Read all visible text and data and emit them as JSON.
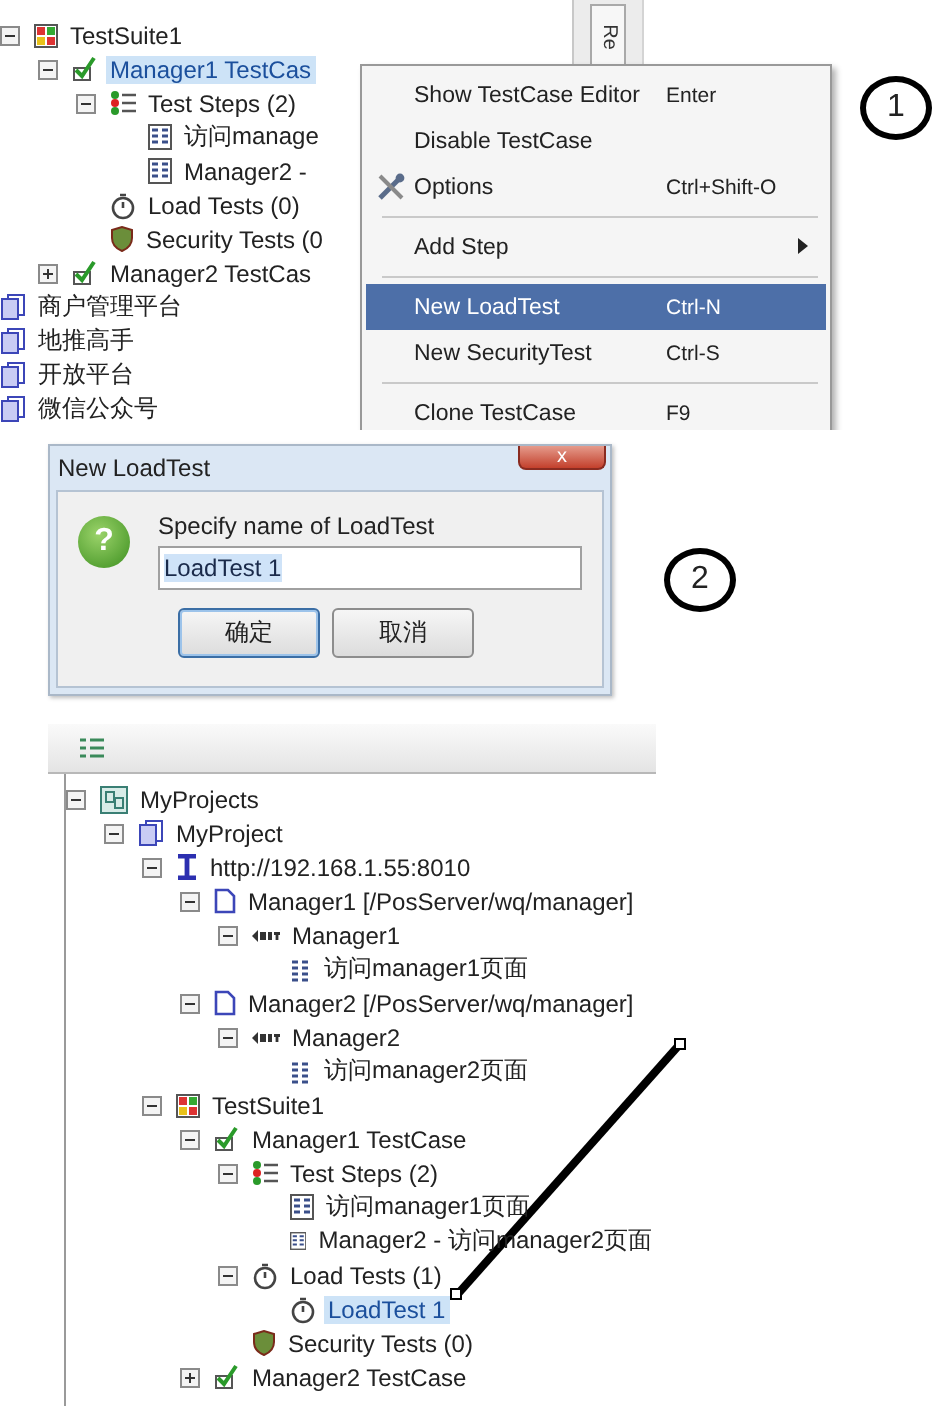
{
  "panel_1": {
    "tree": [
      {
        "label": "TestSuite1",
        "kind": "suite",
        "expanded": true,
        "selected": false,
        "children": [
          {
            "label": "Manager1 TestCas",
            "kind": "testcase",
            "expanded": true,
            "selected": true,
            "children": [
              {
                "label": "Test Steps (2)",
                "kind": "steps",
                "expanded": true,
                "selected": false,
                "children": [
                  {
                    "label": "访问manage",
                    "kind": "request",
                    "selected": false
                  },
                  {
                    "label": "Manager2 -",
                    "kind": "request",
                    "selected": false
                  }
                ]
              },
              {
                "label": "Load Tests (0)",
                "kind": "loadtest",
                "selected": false
              },
              {
                "label": "Security Tests (0",
                "kind": "security",
                "selected": false
              }
            ]
          },
          {
            "label": "Manager2 TestCas",
            "kind": "testcase",
            "expanded": false,
            "selected": false
          }
        ]
      },
      {
        "label": "商户管理平台",
        "kind": "project",
        "selected": false
      },
      {
        "label": "地推高手",
        "kind": "project",
        "selected": false
      },
      {
        "label": "开放平台",
        "kind": "project",
        "selected": false
      },
      {
        "label": "微信公众号",
        "kind": "project",
        "selected": false
      }
    ],
    "side_tab": "Re",
    "context_menu": [
      {
        "kind": "item",
        "label": "Show TestCase Editor",
        "shortcut": "Enter",
        "selected": false
      },
      {
        "kind": "item",
        "label": "Disable TestCase",
        "selected": false
      },
      {
        "kind": "icon_item",
        "label": "Options",
        "shortcut": "Ctrl+Shift-O",
        "selected": false
      },
      {
        "kind": "separator"
      },
      {
        "kind": "submenu",
        "label": "Add Step",
        "selected": false
      },
      {
        "kind": "separator"
      },
      {
        "kind": "item",
        "label": "New LoadTest",
        "shortcut": "Ctrl-N",
        "selected": true
      },
      {
        "kind": "item",
        "label": "New SecurityTest",
        "shortcut": "Ctrl-S",
        "selected": false
      },
      {
        "kind": "separator"
      },
      {
        "kind": "item",
        "label": "Clone TestCase",
        "shortcut": "F9",
        "selected": false
      }
    ],
    "step_marker": "1"
  },
  "panel_2": {
    "dialog": {
      "title": "New LoadTest",
      "close": "x",
      "help_icon": "?",
      "prompt": "Specify name of LoadTest",
      "value": "LoadTest 1",
      "value_selected": true,
      "buttons": [
        {
          "label": "确定",
          "default": true
        },
        {
          "label": "取消",
          "default": false
        }
      ]
    },
    "step_marker": "2"
  },
  "panel_3": {
    "tree": [
      {
        "label": "MyProjects",
        "kind": "projects",
        "selected": false,
        "expanded": true,
        "children": [
          {
            "label": "MyProject",
            "kind": "project",
            "expanded": true,
            "selected": false,
            "children": [
              {
                "label": "http://192.168.1.55:8010",
                "kind": "interface",
                "expanded": true,
                "selected": false,
                "children": [
                  {
                    "label": "Manager1 [/PosServer/wq/manager]",
                    "kind": "resource",
                    "expanded": true,
                    "selected": false,
                    "children": [
                      {
                        "label": "Manager1",
                        "kind": "method",
                        "expanded": true,
                        "selected": false,
                        "children": [
                          {
                            "label": "访问manager1页面",
                            "kind": "request_item",
                            "selected": false
                          }
                        ]
                      }
                    ]
                  },
                  {
                    "label": "Manager2 [/PosServer/wq/manager]",
                    "kind": "resource",
                    "expanded": true,
                    "selected": false,
                    "children": [
                      {
                        "label": "Manager2",
                        "kind": "method",
                        "expanded": true,
                        "selected": false,
                        "children": [
                          {
                            "label": "访问manager2页面",
                            "kind": "request_item",
                            "selected": false
                          }
                        ]
                      }
                    ]
                  }
                ]
              },
              {
                "label": "TestSuite1",
                "kind": "suite",
                "expanded": true,
                "selected": false,
                "children": [
                  {
                    "label": "Manager1 TestCase",
                    "kind": "testcase",
                    "expanded": true,
                    "selected": false,
                    "children": [
                      {
                        "label": "Test Steps (2)",
                        "kind": "steps",
                        "expanded": true,
                        "selected": false,
                        "children": [
                          {
                            "label": "访问manager1页面",
                            "kind": "request",
                            "selected": false
                          },
                          {
                            "label": "Manager2 - 访问manager2页面",
                            "kind": "request",
                            "selected": false
                          }
                        ]
                      },
                      {
                        "label": "Load Tests (1)",
                        "kind": "loadtest",
                        "expanded": true,
                        "selected": false,
                        "children": [
                          {
                            "label": "LoadTest 1",
                            "kind": "loadtest",
                            "selected": true
                          }
                        ]
                      },
                      {
                        "label": "Security Tests (0)",
                        "kind": "security",
                        "selected": false
                      }
                    ]
                  },
                  {
                    "label": "Manager2 TestCase",
                    "kind": "testcase",
                    "expanded": false,
                    "selected": false
                  }
                ]
              }
            ]
          }
        ]
      }
    ]
  }
}
